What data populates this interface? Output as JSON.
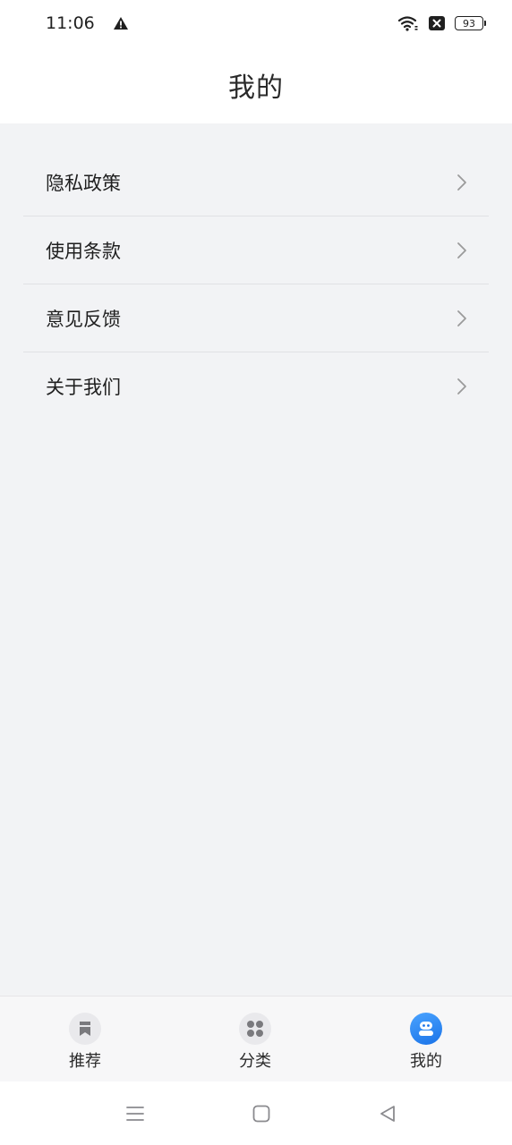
{
  "status_bar": {
    "time": "11:06",
    "icons": [
      "warning-icon",
      "wifi-icon",
      "sim-off-icon"
    ],
    "battery": "93"
  },
  "header": {
    "title": "我的"
  },
  "menu": {
    "items": [
      {
        "label": "隐私政策",
        "icon": "chevron-right-icon"
      },
      {
        "label": "使用条款",
        "icon": "chevron-right-icon"
      },
      {
        "label": "意见反馈",
        "icon": "chevron-right-icon"
      },
      {
        "label": "关于我们",
        "icon": "chevron-right-icon"
      }
    ]
  },
  "tab_bar": {
    "tabs": [
      {
        "label": "推荐",
        "icon": "bookmark-icon",
        "active": false
      },
      {
        "label": "分类",
        "icon": "grid-icon",
        "active": false
      },
      {
        "label": "我的",
        "icon": "robot-face-icon",
        "active": true
      }
    ]
  },
  "nav_bar": {
    "icons": [
      "menu-icon",
      "home-square-icon",
      "back-triangle-icon"
    ]
  },
  "colors": {
    "background": "#f2f3f5",
    "surface": "#ffffff",
    "accent": "#1a73e8",
    "text": "#1f1f1f",
    "chevron": "#9a9a9a"
  }
}
